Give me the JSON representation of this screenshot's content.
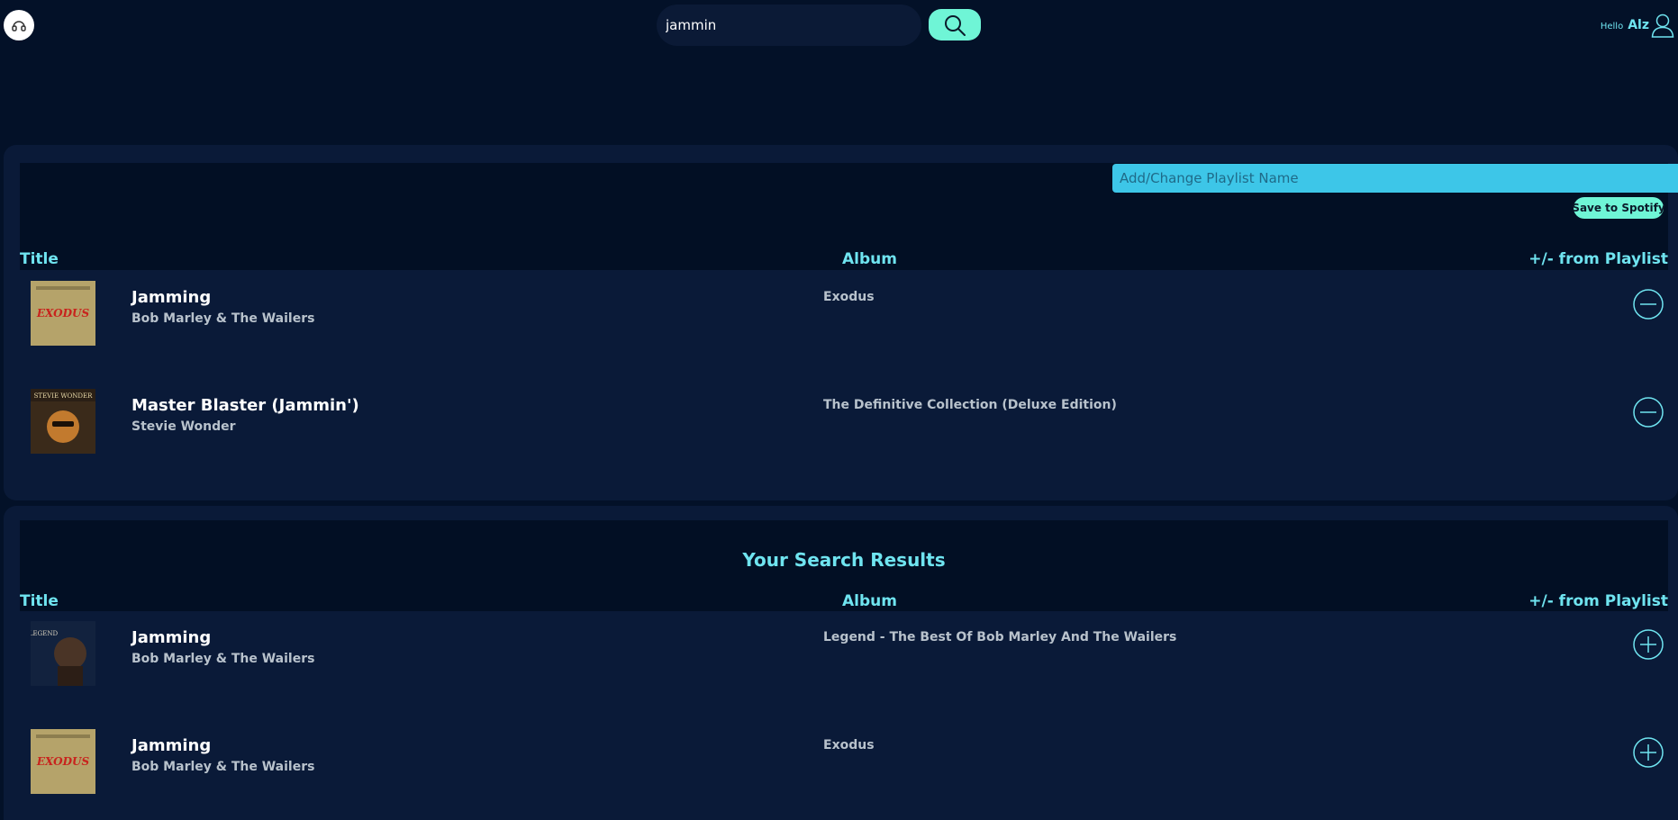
{
  "header": {
    "logo_icon": "headphones-icon",
    "search": {
      "value": "jammin",
      "placeholder": ""
    },
    "search_button_icon": "search-icon",
    "greeting": "Hello",
    "username": "Alz",
    "user_icon": "user-icon"
  },
  "playlist": {
    "name_placeholder": "Add/Change Playlist Name",
    "save_label": "Save to Spotify",
    "columns": {
      "title": "Title",
      "album": "Album",
      "action": "+/- from Playlist"
    },
    "tracks": [
      {
        "title": "Jamming",
        "artist": "Bob Marley & The Wailers",
        "album": "Exodus",
        "action_icon": "minus-circle-icon"
      },
      {
        "title": "Master Blaster (Jammin')",
        "artist": "Stevie Wonder",
        "album": "The Definitive Collection (Deluxe Edition)",
        "action_icon": "minus-circle-icon"
      }
    ]
  },
  "results": {
    "heading": "Your Search Results",
    "columns": {
      "title": "Title",
      "album": "Album",
      "action": "+/- from Playlist"
    },
    "tracks": [
      {
        "title": "Jamming",
        "artist": "Bob Marley & The Wailers",
        "album": "Legend - The Best Of Bob Marley And The Wailers",
        "action_icon": "plus-circle-icon"
      },
      {
        "title": "Jamming",
        "artist": "Bob Marley & The Wailers",
        "album": "Exodus",
        "action_icon": "plus-circle-icon"
      }
    ]
  },
  "colors": {
    "background": "#031128",
    "panel": "#0a1a38",
    "accent": "#6fe4f0",
    "button": "#6ff5d6",
    "playlist_input": "#3dc6e8"
  }
}
